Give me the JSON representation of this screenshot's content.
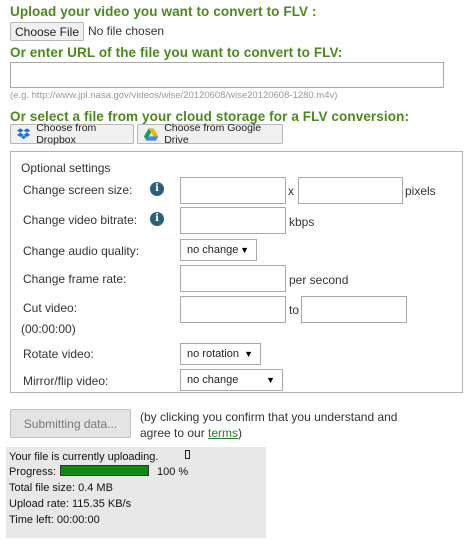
{
  "upload": {
    "heading": "Upload your video you want to convert to FLV :",
    "choose_file_label": "Choose File",
    "no_file_text": "No file chosen"
  },
  "url": {
    "heading": "Or enter URL of the file you want to convert to FLV:",
    "value": "",
    "example": "(e.g. http://www.jpl.nasa.gov/videos/wise/20120608/wise20120608-1280.m4v)"
  },
  "cloud": {
    "heading": "Or select a file from your cloud storage for a FLV conversion:",
    "dropbox_label": "Choose from Dropbox",
    "gdrive_label": "Choose from Google Drive"
  },
  "settings": {
    "title": "Optional settings",
    "screen_size": {
      "label": "Change screen size:",
      "sep": "x",
      "unit": "pixels",
      "width": "",
      "height": ""
    },
    "bitrate": {
      "label": "Change video bitrate:",
      "unit": "kbps",
      "value": ""
    },
    "audio": {
      "label": "Change audio quality:",
      "selected": "no change"
    },
    "frame_rate": {
      "label": "Change frame rate:",
      "unit": "per second",
      "value": ""
    },
    "cut": {
      "label": "Cut video:",
      "sep": "to",
      "start": "",
      "end": "",
      "time_display": "(00:00:00)"
    },
    "rotate": {
      "label": "Rotate video:",
      "selected": "no rotation"
    },
    "mirror": {
      "label": "Mirror/flip video:",
      "selected": "no change"
    }
  },
  "submit": {
    "button_label": "Submitting data...",
    "notice_1": "(by clicking you confirm that you understand and",
    "notice_2": "agree to our ",
    "terms_link": "terms",
    "notice_end": ")"
  },
  "status": {
    "uploading": "Your file is currently uploading.",
    "progress_label": "Progress:",
    "progress_percent": 100,
    "progress_text": "100 %",
    "total_size": "Total file size: 0.4 MB",
    "upload_rate": "Upload rate: 115.35 KB/s",
    "time_left": "Time left: 00:00:00",
    "colors": {
      "progress_fill": "#118811",
      "box_bg": "#e8e8e8"
    }
  },
  "colors": {
    "heading_green": "#4a8a1c",
    "info_icon": "#2b5f7a"
  }
}
